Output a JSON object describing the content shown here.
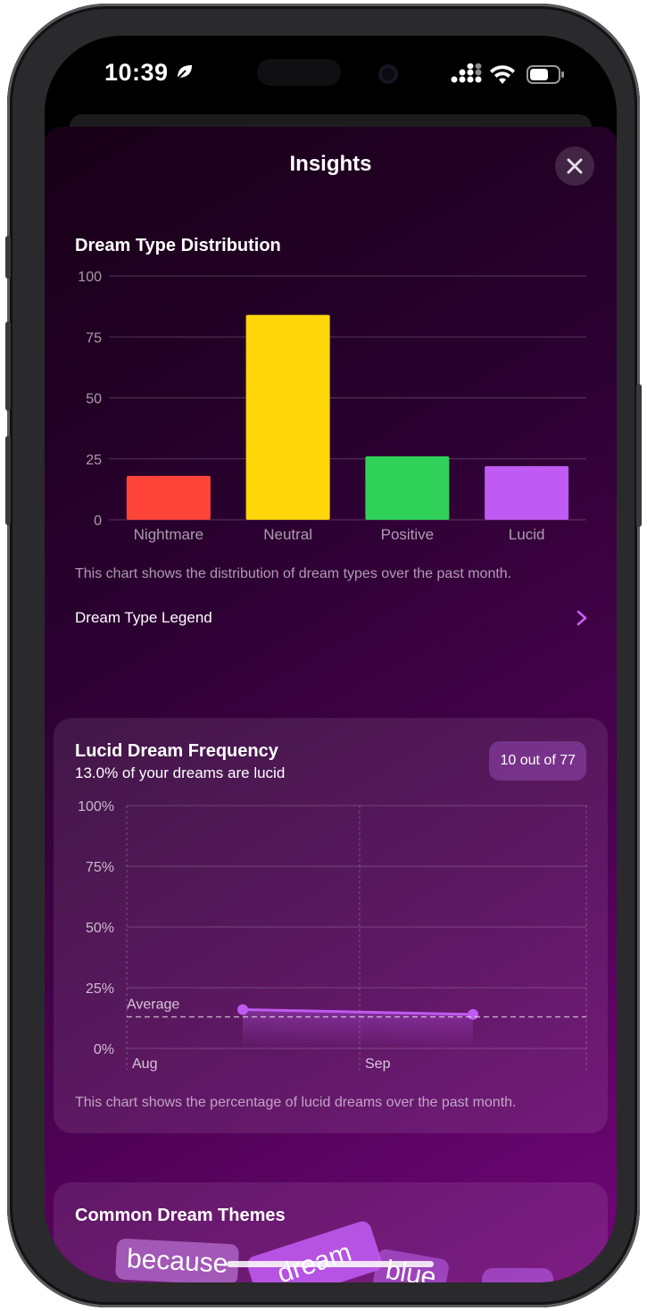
{
  "status_bar": {
    "time": "10:39"
  },
  "header": {
    "title": "Insights"
  },
  "dream_type": {
    "title": "Dream Type Distribution",
    "caption": "This chart shows the distribution of dream types over the past month.",
    "legend_link": "Dream Type Legend",
    "colors": {
      "Nightmare": "#ff453a",
      "Neutral": "#ffd60a",
      "Positive": "#30d158",
      "Lucid": "#bf5af2"
    }
  },
  "lucid": {
    "title": "Lucid Dream Frequency",
    "subtitle": "13.0% of your dreams are lucid",
    "badge": "10 out of 77",
    "average_label": "Average",
    "caption": "This chart shows the percentage of lucid dreams over the past month."
  },
  "themes": {
    "title": "Common Dream Themes",
    "words": [
      "because",
      "dream",
      "blue"
    ]
  },
  "chart_data": [
    {
      "type": "bar",
      "title": "Dream Type Distribution",
      "categories": [
        "Nightmare",
        "Neutral",
        "Positive",
        "Lucid"
      ],
      "values": [
        18,
        84,
        26,
        22
      ],
      "ylim": [
        0,
        100
      ],
      "yticks": [
        "100",
        "75",
        "50",
        "25",
        "0"
      ],
      "grid": true
    },
    {
      "type": "line",
      "title": "Lucid Dream Frequency",
      "x_ticks": [
        "Aug",
        "Sep"
      ],
      "yticks": [
        "100%",
        "75%",
        "50%",
        "25%",
        "0%"
      ],
      "ylim": [
        0,
        100
      ],
      "series": [
        {
          "values": [
            16,
            14
          ]
        }
      ],
      "average": 13.0,
      "grid": true
    }
  ]
}
